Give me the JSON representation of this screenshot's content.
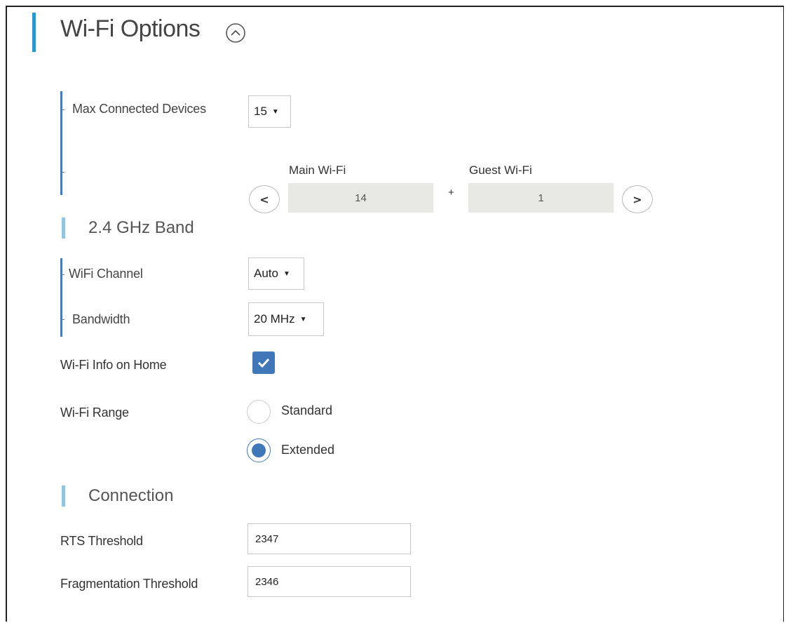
{
  "header": {
    "title": "Wi-Fi Options",
    "collapse_icon": "chevron-up-circle-icon"
  },
  "max_devices": {
    "label": "Max Connected Devices",
    "value": "15",
    "main_label": "Main Wi-Fi",
    "main_value": "14",
    "plus": "+",
    "guest_label": "Guest Wi-Fi",
    "guest_value": "1",
    "prev": "<",
    "next": ">"
  },
  "band": {
    "title": "2.4 GHz Band",
    "channel_label": "WiFi Channel",
    "channel_value": "Auto",
    "bandwidth_label": "Bandwidth",
    "bandwidth_value": "20 MHz"
  },
  "home_info": {
    "label": "Wi-Fi Info on Home",
    "checked": true
  },
  "range": {
    "label": "Wi-Fi Range",
    "options": [
      {
        "label": "Standard",
        "selected": false
      },
      {
        "label": "Extended",
        "selected": true
      }
    ]
  },
  "connection": {
    "title": "Connection",
    "rts_label": "RTS Threshold",
    "rts_value": "2347",
    "frag_label": "Fragmentation Threshold",
    "frag_value": "2346"
  },
  "colors": {
    "accent": "#1f9ad6",
    "control_blue": "#3f77b8",
    "section_bar": "#8fc6e8",
    "gray_box": "#e8e8e4"
  }
}
